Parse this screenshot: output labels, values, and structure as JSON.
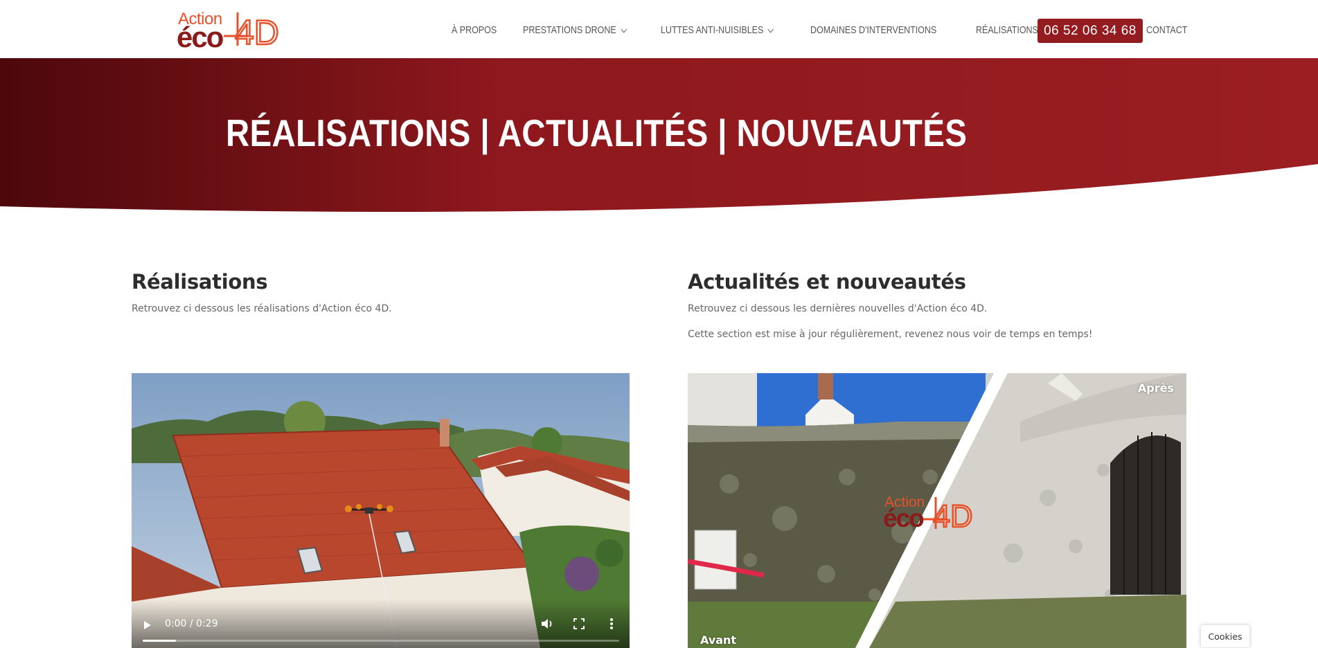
{
  "header": {
    "logo": {
      "line1": "Action",
      "line2": "éco",
      "mark": "4D"
    },
    "nav": [
      {
        "label": "À propos",
        "has_dropdown": false
      },
      {
        "label": "Prestations drone",
        "has_dropdown": true
      },
      {
        "label": "Luttes anti-nuisibles",
        "has_dropdown": true
      },
      {
        "label": "Domaines d'interventions",
        "has_dropdown": false
      },
      {
        "label": "Réalisations et actualités",
        "has_dropdown": false
      },
      {
        "label": "Contact",
        "has_dropdown": false
      }
    ],
    "phone": "06 52 06 34 68"
  },
  "hero": {
    "title": "RÉALISATIONS | ACTUALITÉS | NOUVEAUTÉS"
  },
  "realisations": {
    "heading": "Réalisations",
    "text": "Retrouvez ci dessous les réalisations d'Action éco 4D.",
    "video": {
      "time": "0:00 / 0:29",
      "progress_fraction": 0.07
    }
  },
  "actualites": {
    "heading": "Actualités et nouveautés",
    "text1": "Retrouvez ci dessous les dernières nouvelles d'Action éco 4D.",
    "text2": "Cette section est mise à jour régulièrement, revenez nous voir de temps en temps!",
    "image": {
      "label_after": "Après",
      "label_before": "Avant",
      "watermark": {
        "line1": "Action",
        "line2": "éco",
        "mark": "4D"
      }
    }
  },
  "cookies": "Cookies",
  "colors": {
    "brand_red": "#921c1f",
    "brand_orange": "#e8502a",
    "hero_dark": "#5a0a0e"
  }
}
